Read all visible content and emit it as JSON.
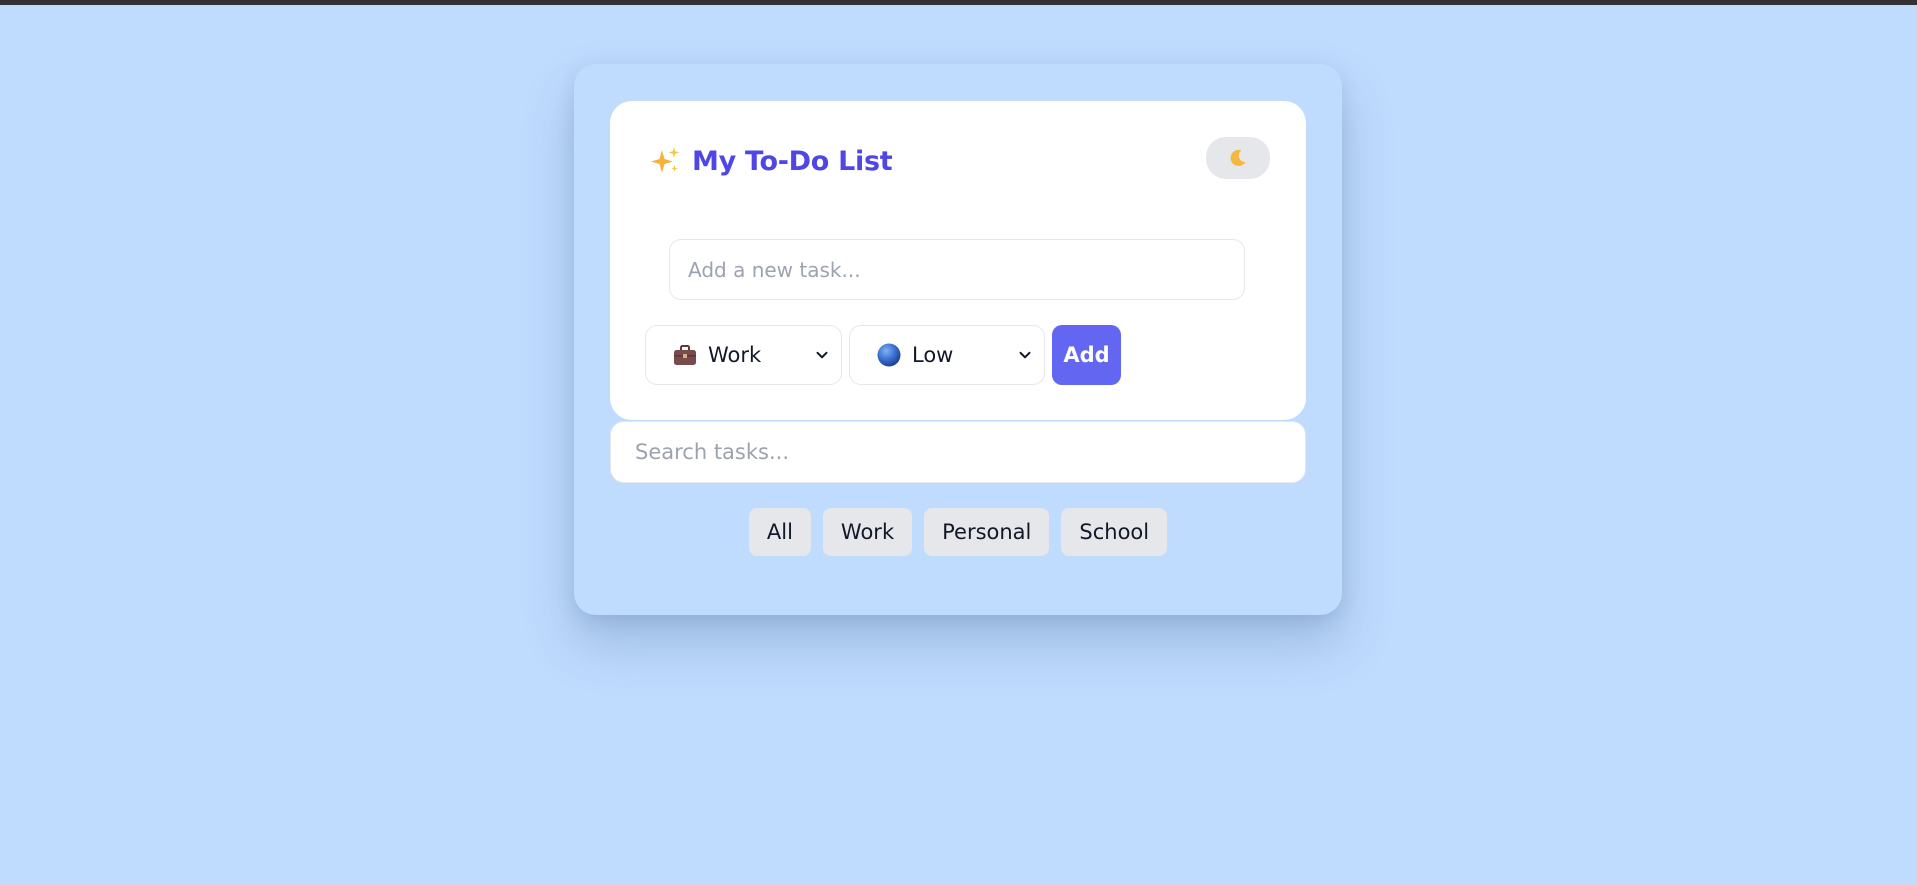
{
  "app": {
    "title": "My To-Do List",
    "theme_toggle_icon": "moon-icon"
  },
  "new_task": {
    "placeholder": "Add a new task...",
    "value": ""
  },
  "category_select": {
    "selected": "Work",
    "icon": "briefcase-icon"
  },
  "priority_select": {
    "selected": "Low",
    "icon": "blue-circle-icon"
  },
  "add_button": {
    "label": "Add"
  },
  "search": {
    "placeholder": "Search tasks...",
    "value": ""
  },
  "filters": [
    {
      "label": "All"
    },
    {
      "label": "Work"
    },
    {
      "label": "Personal"
    },
    {
      "label": "School"
    }
  ],
  "colors": {
    "background": "#bfdbfe",
    "accent": "#6366f1",
    "title": "#4f46e5",
    "chip": "#e5e7eb"
  }
}
